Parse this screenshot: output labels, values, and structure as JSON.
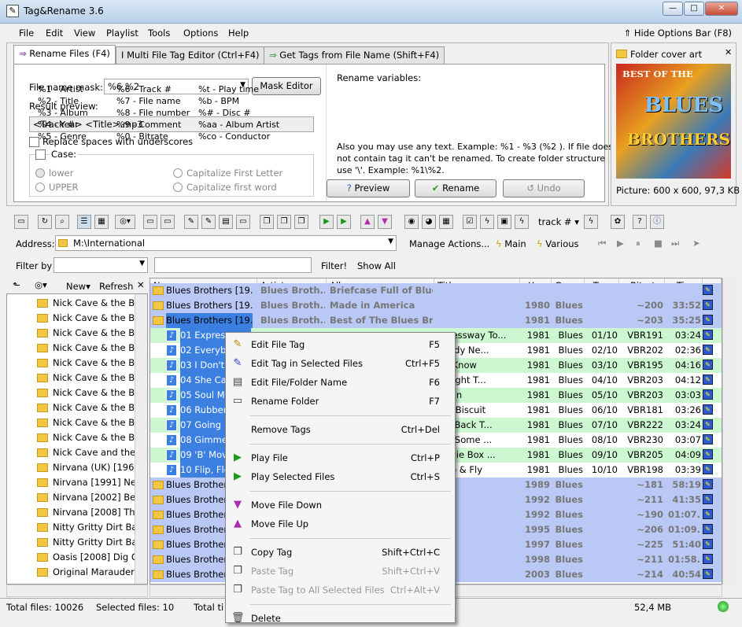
{
  "window": {
    "title": "Tag&Rename 3.6"
  },
  "menu": [
    "File",
    "Edit",
    "View",
    "Playlist",
    "Tools",
    "Options",
    "Help"
  ],
  "hide_options": "Hide Options Bar (F8)",
  "tabs": [
    {
      "label": "Rename Files (F4)"
    },
    {
      "label": "Multi File Tag Editor (Ctrl+F4)"
    },
    {
      "label": "Get Tags from File Name (Shift+F4)"
    }
  ],
  "rename": {
    "mask_label": "File name mask:",
    "mask_value": "%6 %2",
    "mask_editor": "Mask Editor",
    "preview_label": "Result preview:",
    "preview_value": "<Track #> <Title>.mp3",
    "replace_spaces": "Replace spaces with underscores",
    "case_label": "Case:",
    "case_options": [
      "lower",
      "UPPER",
      "Capitalize First Letter",
      "Capitalize first word"
    ],
    "vars_title": "Rename variables:",
    "vars": [
      [
        "%1 - Artist",
        "%6 - Track #",
        "%t - Play time"
      ],
      [
        "%2 - Title",
        "%7 - File name",
        "%b - BPM"
      ],
      [
        "%3 - Album",
        "%8 - File number",
        "%# - Disc #"
      ],
      [
        "%4 - Year",
        "%9 - Comment",
        "%aa - Album Artist"
      ],
      [
        "%5 - Genre",
        "%0 - Bitrate",
        "%co - Conductor"
      ]
    ],
    "note": [
      "Also you may use any text. Example: %1 - %3 (%2 ). If file does",
      "not contain tag it can't be renamed. To create folder structure",
      "use '\\'. Example: %1\\%2."
    ],
    "preview_btn": "Preview",
    "rename_btn": "Rename",
    "undo_btn": "Undo"
  },
  "cover": {
    "title": "Folder cover art",
    "art_text": [
      "BEST OF THE",
      "BLUES",
      "BROTHERS"
    ],
    "info": "Picture: 600 x 600, 97,3 KB"
  },
  "toolbar": {
    "track_dropdown": "track #"
  },
  "address": {
    "label": "Address:",
    "value": "M:\\International",
    "manage": "Manage Actions...",
    "main": "Main",
    "various": "Various"
  },
  "filter": {
    "label": "Filter by",
    "filter_btn": "Filter!",
    "show_all": "Show All"
  },
  "tree_toolbar": {
    "new": "New",
    "refresh": "Refresh"
  },
  "tree": [
    "Nick Cave & the Ba",
    "Nick Cave & the Ba",
    "Nick Cave & the Ba",
    "Nick Cave & the Ba",
    "Nick Cave & the Ba",
    "Nick Cave & the Ba",
    "Nick Cave & the Ba",
    "Nick Cave & the Ba",
    "Nick Cave & the Ba",
    "Nick Cave & the Ba",
    "Nick Cave and the B",
    "Nirvana (UK) [1968]",
    "Nirvana [1991] Neve",
    "Nirvana [2002] Best",
    "Nirvana [2008] The",
    "Nitty Gritty Dirt Ban",
    "Nitty Gritty Dirt Ban",
    "Oasis [2008] Dig Ou",
    "Original Marauders"
  ],
  "columns": [
    "Name",
    "Artist",
    "Album",
    "Title",
    "Year",
    "Genre",
    "Tra...",
    "Bitrate",
    "Time"
  ],
  "rows": [
    {
      "type": "album",
      "name": "Blues Brothers [19...",
      "artist": "Blues Broth...",
      "album": "Briefcase Full of Blues",
      "title": "",
      "year": "",
      "genre": "",
      "track": "",
      "bitrate": "",
      "time": ""
    },
    {
      "type": "album",
      "name": "Blues Brothers [19...",
      "artist": "Blues Broth...",
      "album": "Made in America",
      "title": "",
      "year": "1980",
      "genre": "Blues",
      "track": "",
      "bitrate": "~200",
      "time": "33:52"
    },
    {
      "type": "album",
      "name": "Blues Brothers [19...",
      "artist": "Blues Broth...",
      "album": "Best of The Blues Br...",
      "title": "",
      "year": "1981",
      "genre": "Blues",
      "track": "",
      "bitrate": "~203",
      "time": "35:25",
      "sel": true
    },
    {
      "type": "green",
      "name": "01 Express",
      "artist": "",
      "album": "",
      "title": "xpressway To...",
      "year": "1981",
      "genre": "Blues",
      "track": "01/10",
      "bitrate": "VBR191",
      "time": "03:24"
    },
    {
      "type": "white",
      "name": "02 Everyb",
      "artist": "",
      "album": "",
      "title": "ybody Ne...",
      "year": "1981",
      "genre": "Blues",
      "track": "02/10",
      "bitrate": "VBR202",
      "time": "02:36"
    },
    {
      "type": "green",
      "name": "03 I Don't",
      "artist": "",
      "album": "",
      "title": "n't Know",
      "year": "1981",
      "genre": "Blues",
      "track": "03/10",
      "bitrate": "VBR195",
      "time": "04:16"
    },
    {
      "type": "white",
      "name": "04 She Ca",
      "artist": "",
      "album": "",
      "title": "Caught T...",
      "year": "1981",
      "genre": "Blues",
      "track": "04/10",
      "bitrate": "VBR203",
      "time": "04:12"
    },
    {
      "type": "green",
      "name": "05 Soul M",
      "artist": "",
      "album": "",
      "title": "l Man",
      "year": "1981",
      "genre": "Blues",
      "track": "05/10",
      "bitrate": "VBR203",
      "time": "03:03"
    },
    {
      "type": "white",
      "name": "06 Rubber",
      "artist": "",
      "album": "",
      "title": "ber Biscuit",
      "year": "1981",
      "genre": "Blues",
      "track": "06/10",
      "bitrate": "VBR181",
      "time": "03:26"
    },
    {
      "type": "green",
      "name": "07 Going",
      "artist": "",
      "album": "",
      "title": "ing Back T...",
      "year": "1981",
      "genre": "Blues",
      "track": "07/10",
      "bitrate": "VBR222",
      "time": "03:24"
    },
    {
      "type": "white",
      "name": "08 Gimme",
      "artist": "",
      "album": "",
      "title": "me Some ...",
      "year": "1981",
      "genre": "Blues",
      "track": "08/10",
      "bitrate": "VBR230",
      "time": "03:07"
    },
    {
      "type": "green",
      "name": "09 'B' Mov",
      "artist": "",
      "album": "",
      "title": "Movie Box ...",
      "year": "1981",
      "genre": "Blues",
      "track": "09/10",
      "bitrate": "VBR205",
      "time": "04:09"
    },
    {
      "type": "white",
      "name": "10 Flip, Flo",
      "artist": "",
      "album": "",
      "title": "Flop & Fly",
      "year": "1981",
      "genre": "Blues",
      "track": "10/10",
      "bitrate": "VBR198",
      "time": "03:39"
    },
    {
      "type": "album",
      "name": "Blues Brother",
      "artist": "",
      "album": "",
      "title": "",
      "year": "1989",
      "genre": "Blues",
      "track": "",
      "bitrate": "~181",
      "time": "58:19"
    },
    {
      "type": "album",
      "name": "Blues Brother",
      "artist": "",
      "album": "",
      "title": "",
      "year": "1992",
      "genre": "Blues",
      "track": "",
      "bitrate": "~211",
      "time": "41:35"
    },
    {
      "type": "album",
      "name": "Blues Brother",
      "artist": "",
      "album": "",
      "title": "",
      "year": "1992",
      "genre": "Blues",
      "track": "",
      "bitrate": "~190",
      "time": "01:07..."
    },
    {
      "type": "album",
      "name": "Blues Brother",
      "artist": "",
      "album": "",
      "title": "",
      "year": "1995",
      "genre": "Blues",
      "track": "",
      "bitrate": "~206",
      "time": "01:09..."
    },
    {
      "type": "album",
      "name": "Blues Brother",
      "artist": "",
      "album": "",
      "title": "",
      "year": "1997",
      "genre": "Blues",
      "track": "",
      "bitrate": "~225",
      "time": "51:40"
    },
    {
      "type": "album",
      "name": "Blues Brother",
      "artist": "",
      "album": "",
      "title": "",
      "year": "1998",
      "genre": "Blues",
      "track": "",
      "bitrate": "~211",
      "time": "01:58..."
    },
    {
      "type": "album",
      "name": "Blues Brother",
      "artist": "",
      "album": "",
      "title": "",
      "year": "2003",
      "genre": "Blues",
      "track": "",
      "bitrate": "~214",
      "time": "40:54"
    }
  ],
  "context_menu": [
    {
      "label": "Edit File Tag",
      "shortcut": "F5",
      "icon": "pencil-icon",
      "glyph": "✎"
    },
    {
      "label": "Edit Tag in Selected Files",
      "shortcut": "Ctrl+F5",
      "icon": "pencil-multi-icon",
      "glyph": "✎"
    },
    {
      "label": "Edit File/Folder Name",
      "shortcut": "F6",
      "icon": "rename-icon",
      "glyph": "▤"
    },
    {
      "label": "Rename Folder",
      "shortcut": "F7",
      "icon": "folder-icon",
      "glyph": "▭"
    },
    {
      "sep": true
    },
    {
      "label": "Remove Tags",
      "shortcut": "Ctrl+Del",
      "icon": "",
      "glyph": ""
    },
    {
      "sep": true
    },
    {
      "label": "Play File",
      "shortcut": "Ctrl+P",
      "icon": "play-icon",
      "glyph": "▶"
    },
    {
      "label": "Play Selected Files",
      "shortcut": "Ctrl+S",
      "icon": "play-selected-icon",
      "glyph": "▶"
    },
    {
      "sep": true
    },
    {
      "label": "Move File Down",
      "shortcut": "",
      "icon": "arrow-down-icon",
      "glyph": "▼"
    },
    {
      "label": "Move File Up",
      "shortcut": "",
      "icon": "arrow-up-icon",
      "glyph": "▲"
    },
    {
      "sep": true
    },
    {
      "label": "Copy Tag",
      "shortcut": "Shift+Ctrl+C",
      "icon": "copy-icon",
      "glyph": "❐"
    },
    {
      "label": "Paste Tag",
      "shortcut": "Shift+Ctrl+V",
      "icon": "paste-icon",
      "glyph": "❐",
      "disabled": true
    },
    {
      "label": "Paste Tag to All Selected Files",
      "shortcut": "Ctrl+Alt+V",
      "icon": "paste-all-icon",
      "glyph": "❐",
      "disabled": true
    },
    {
      "sep": true
    },
    {
      "label": "Delete",
      "shortcut": "",
      "icon": "trash-icon",
      "glyph": "🗑"
    }
  ],
  "status": {
    "total_files": "Total files: 10026",
    "selected_files": "Selected files: 10",
    "total_ti": "Total ti",
    "size": "52,4 MB"
  },
  "colors": {
    "selection": "#3b7fe0",
    "album_row": "#b9c8f5",
    "green_row": "#ccf7d1"
  }
}
